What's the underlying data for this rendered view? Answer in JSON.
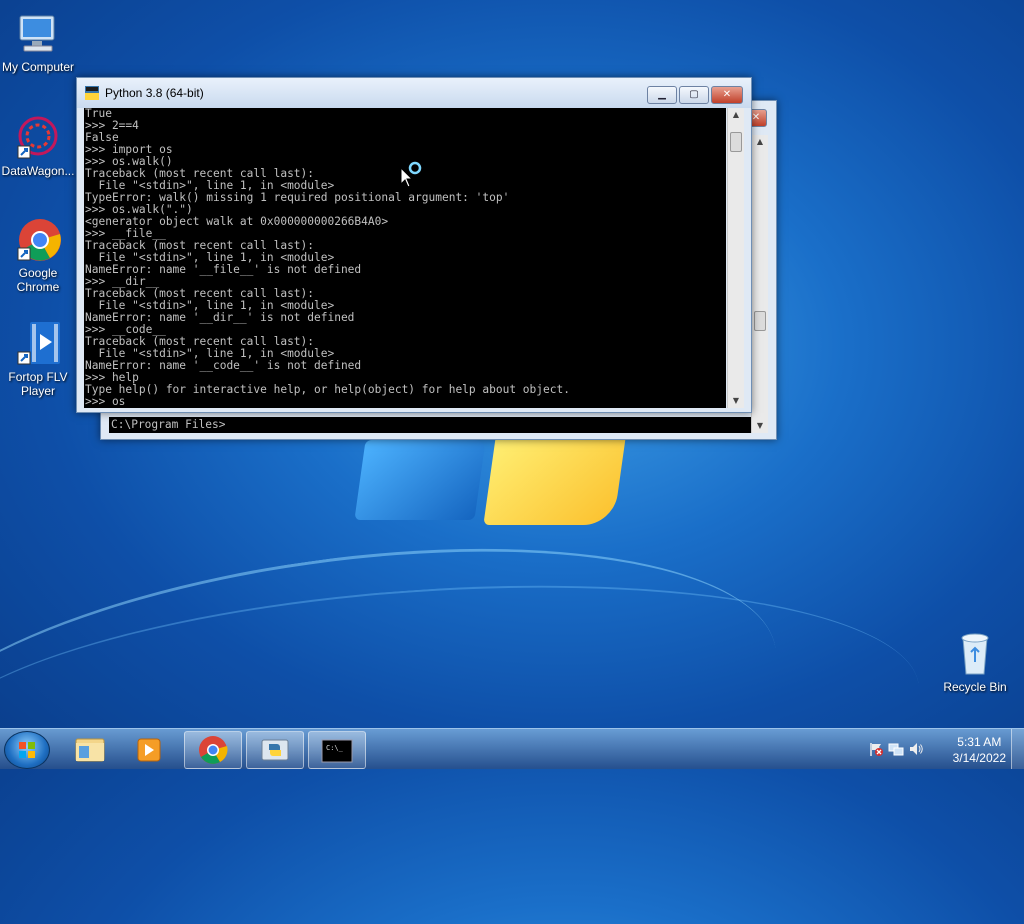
{
  "desktop": {
    "icons": [
      {
        "label": "My Computer",
        "icon": "computer-icon"
      },
      {
        "label": "DataWagon...",
        "icon": "datawagon-icon"
      },
      {
        "label": "Google Chrome",
        "icon": "chrome-icon"
      },
      {
        "label": "Fortop FLV Player",
        "icon": "flv-player-icon"
      },
      {
        "label": "Recycle Bin",
        "icon": "recycle-bin-icon"
      }
    ]
  },
  "python_window": {
    "title": "Python 3.8 (64-bit)",
    "lines": [
      "True",
      ">>> 2==4",
      "False",
      ">>> import os",
      ">>> os.walk()",
      "Traceback (most recent call last):",
      "  File \"<stdin>\", line 1, in <module>",
      "TypeError: walk() missing 1 required positional argument: 'top'",
      ">>> os.walk(\".\")",
      "<generator object walk at 0x000000000266B4A0>",
      ">>> __file__",
      "Traceback (most recent call last):",
      "  File \"<stdin>\", line 1, in <module>",
      "NameError: name '__file__' is not defined",
      ">>> __dir__",
      "Traceback (most recent call last):",
      "  File \"<stdin>\", line 1, in <module>",
      "NameError: name '__dir__' is not defined",
      ">>> __code__",
      "Traceback (most recent call last):",
      "  File \"<stdin>\", line 1, in <module>",
      "NameError: name '__code__' is not defined",
      ">>> help",
      "Type help() for interactive help, or help(object) for help about object.",
      ">>> os"
    ]
  },
  "cmd_window": {
    "prompt": "C:\\Program Files>"
  },
  "taskbar": {
    "time": "5:31 AM",
    "date": "3/14/2022",
    "cmd_label": "C:\\_"
  },
  "colors": {
    "console_bg": "#000000",
    "console_fg": "#c0c0c0",
    "taskbar": "#2f5f9e"
  }
}
